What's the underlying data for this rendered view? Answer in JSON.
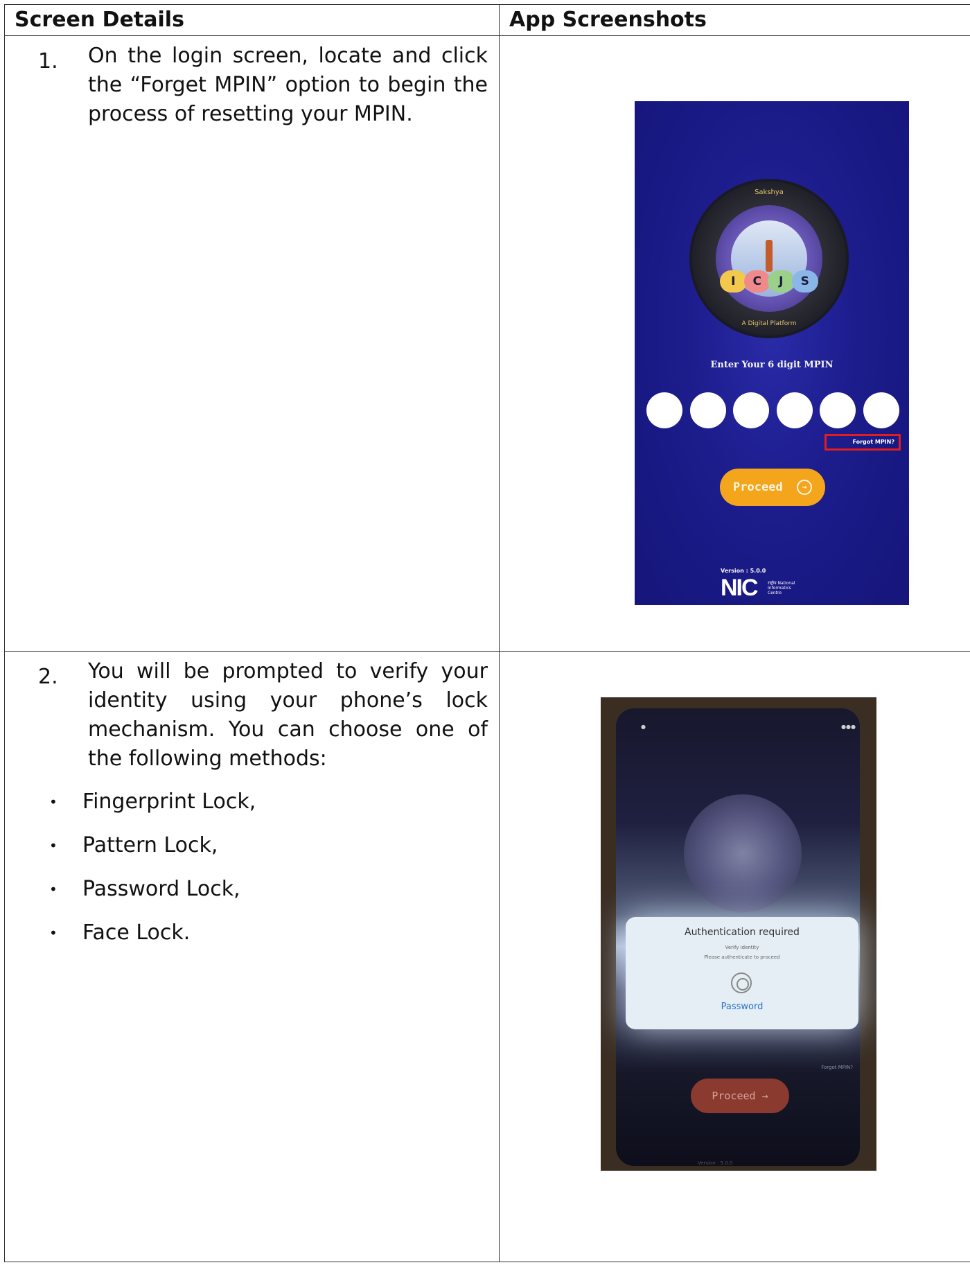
{
  "table": {
    "header_left": "Screen Details",
    "header_right": "App Screenshots"
  },
  "step1": {
    "number": "1.",
    "text": "On the login screen, locate and click the “Forget MPIN” option to begin the process of resetting your MPIN."
  },
  "step2": {
    "number": "2.",
    "text": "You will be prompted to verify your identity using your phone’s lock mechanism. You can choose one of the following methods:",
    "bullet_symbol": "•",
    "methods": [
      "Fingerprint Lock,",
      "Pattern Lock,",
      "Password Lock,",
      "Face Lock."
    ]
  },
  "screenshot1": {
    "logo_top": "Sakshya",
    "logo_letters": [
      "I",
      "C",
      "J",
      "S"
    ],
    "logo_bottom": "A Digital Platform",
    "mpin_label": "Enter Your 6 digit MPIN",
    "forgot_label": "Forgot MPIN?",
    "proceed_label": "Proceed",
    "proceed_arrow": "→",
    "version": "Version : 5.0.0",
    "nic_logo": "NIC",
    "nic_subtitle": "राष्ट्रीय National Informatics Centre",
    "colors": {
      "background": "#1c1c8c",
      "accent": "#f3a51c",
      "highlight": "#e11d1d"
    }
  },
  "screenshot2": {
    "auth_title": "Authentication required",
    "auth_subtitle": "Verify identity",
    "auth_message": "Please authenticate to proceed",
    "password_link": "Password",
    "forgot_label": "Forgot MPIN?",
    "proceed_label": "Proceed",
    "proceed_arrow": "→",
    "version": "Version : 5.0.0",
    "icons": [
      "fingerprint-icon"
    ]
  }
}
